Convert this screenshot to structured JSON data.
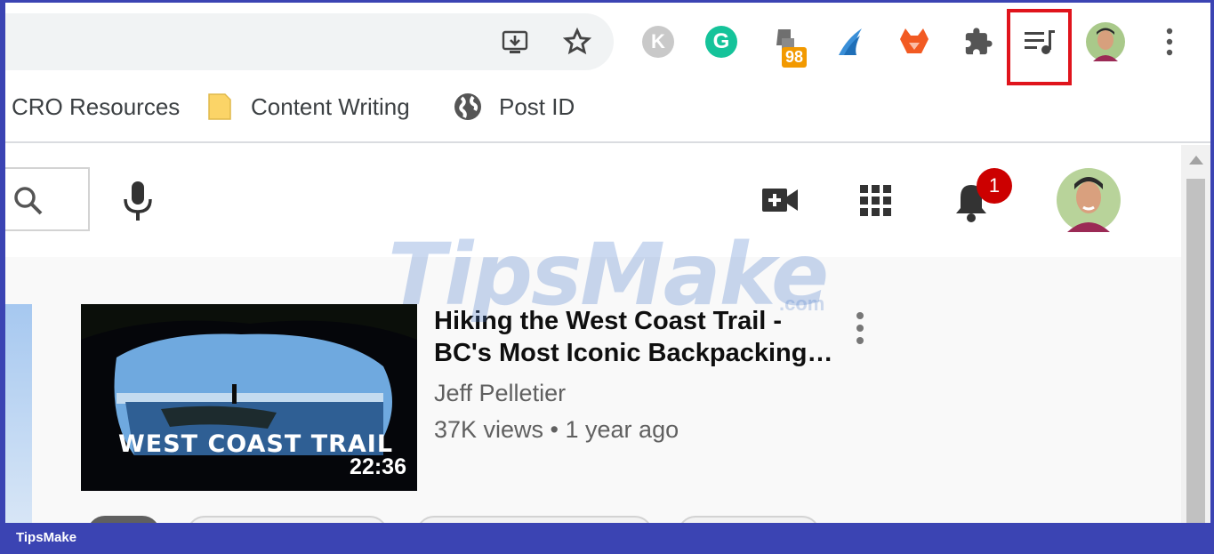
{
  "browser": {
    "extensions": [
      {
        "name": "k-extension",
        "letter": "K"
      },
      {
        "name": "grammarly",
        "letter": "G"
      },
      {
        "name": "puzzle-tool",
        "badge": "98"
      },
      {
        "name": "bird-extension"
      },
      {
        "name": "fox-extension"
      },
      {
        "name": "extensions-puzzle"
      },
      {
        "name": "media-control"
      }
    ]
  },
  "bookmarks": {
    "items": [
      {
        "label": "CRO Resources"
      },
      {
        "label": "Content Writing",
        "icon": "folder-icon"
      },
      {
        "label": "Post ID",
        "icon": "globe-icon"
      }
    ]
  },
  "youtube": {
    "notifications_count": "1",
    "video": {
      "thumbnail_text": "WEST COAST TRAIL",
      "duration": "22:36",
      "title": "Hiking the West Coast Trail - BC's Most Iconic Backpacking…",
      "channel": "Jeff Pelletier",
      "meta": "37K views • 1 year ago"
    }
  },
  "watermark": {
    "brand": "TipsMake",
    "suffix": ".com"
  },
  "footer": {
    "label": "TipsMake"
  },
  "colors": {
    "accent_red": "#e0141c",
    "badge_red": "#cc0000",
    "frame_blue": "#3b44b3"
  }
}
